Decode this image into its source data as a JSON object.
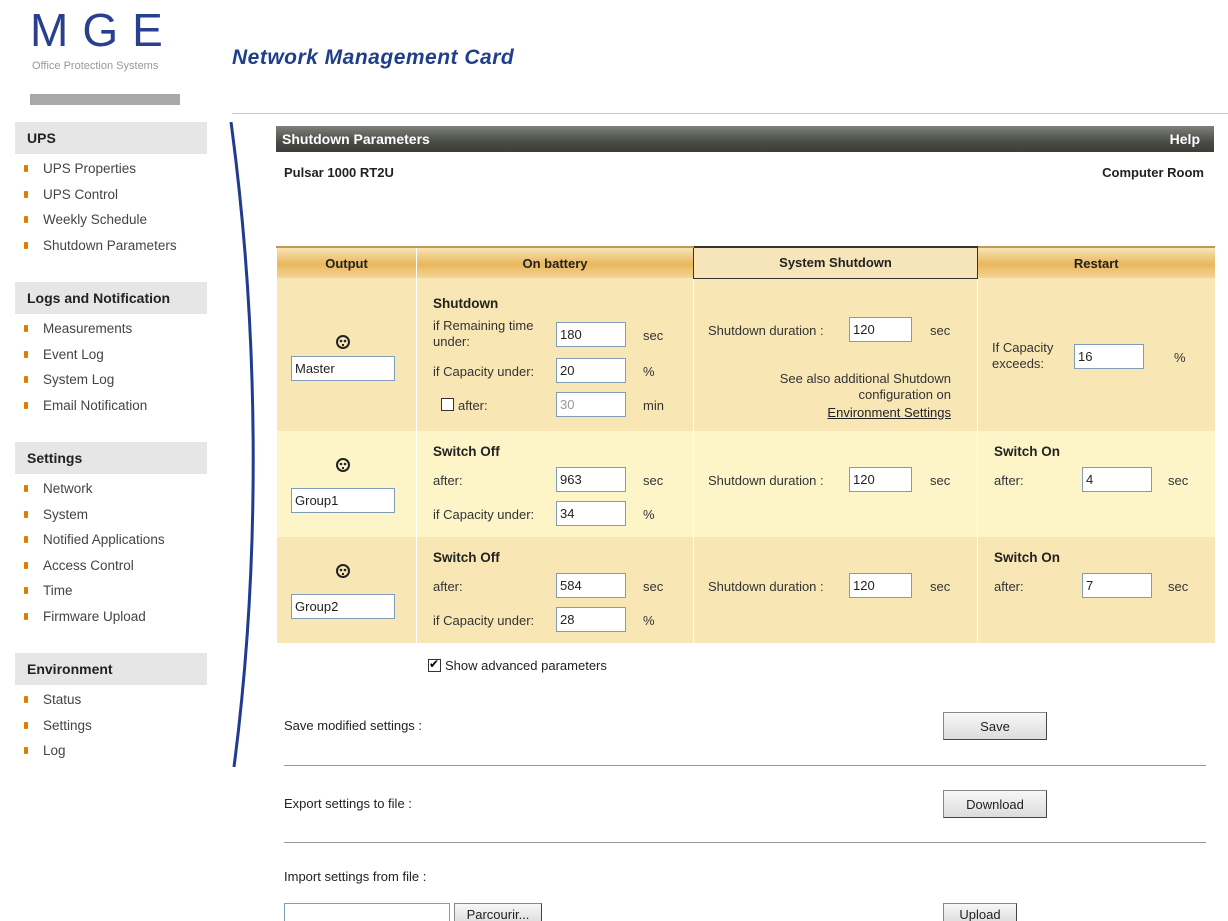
{
  "header": {
    "logo_text": "MGE",
    "logo_subtitle": "Office Protection Systems",
    "title": "Network  Management  Card"
  },
  "sidebar": [
    {
      "heading": "UPS",
      "items": [
        "UPS Properties",
        "UPS Control",
        "Weekly Schedule",
        "Shutdown Parameters"
      ]
    },
    {
      "heading": "Logs and Notification",
      "items": [
        "Measurements",
        "Event Log",
        "System Log",
        "Email Notification"
      ]
    },
    {
      "heading": "Settings",
      "items": [
        "Network",
        "System",
        "Notified Applications",
        "Access Control",
        "Time",
        "Firmware Upload"
      ]
    },
    {
      "heading": "Environment",
      "items": [
        "Status",
        "Settings",
        "Log"
      ]
    }
  ],
  "panel": {
    "title": "Shutdown Parameters",
    "help": "Help",
    "device": "Pulsar 1000 RT2U",
    "location": "Computer Room"
  },
  "table": {
    "headers": [
      "Output",
      "On battery",
      "System Shutdown",
      "Restart"
    ],
    "master": {
      "name": "Master",
      "section": "Shutdown",
      "remaining_label": "if Remaining time under:",
      "remaining_value": "180",
      "remaining_unit": "sec",
      "capacity_label": "if Capacity under:",
      "capacity_value": "20",
      "capacity_unit": "%",
      "after_label": "after:",
      "after_value": "30",
      "after_unit": "min",
      "after_checked": false,
      "shutdown_label": "Shutdown duration :",
      "shutdown_value": "120",
      "shutdown_unit": "sec",
      "note": "See also additional Shutdown configuration on",
      "note_link": "Environment Settings",
      "restart_label": "If Capacity exceeds:",
      "restart_value": "16",
      "restart_unit": "%"
    },
    "group1": {
      "name": "Group1",
      "section": "Switch Off",
      "after_label": "after:",
      "after_value": "963",
      "after_unit": "sec",
      "capacity_label": "if Capacity under:",
      "capacity_value": "34",
      "capacity_unit": "%",
      "shutdown_label": "Shutdown duration :",
      "shutdown_value": "120",
      "shutdown_unit": "sec",
      "restart_section": "Switch On",
      "restart_label": "after:",
      "restart_value": "4",
      "restart_unit": "sec"
    },
    "group2": {
      "name": "Group2",
      "section": "Switch Off",
      "after_label": "after:",
      "after_value": "584",
      "after_unit": "sec",
      "capacity_label": "if Capacity under:",
      "capacity_value": "28",
      "capacity_unit": "%",
      "shutdown_label": "Shutdown duration :",
      "shutdown_value": "120",
      "shutdown_unit": "sec",
      "restart_section": "Switch On",
      "restart_label": "after:",
      "restart_value": "7",
      "restart_unit": "sec"
    }
  },
  "advanced": {
    "label": "Show advanced parameters",
    "checked": true
  },
  "actions": {
    "save_label": "Save modified settings :",
    "save_button": "Save",
    "export_label": "Export settings to file :",
    "export_button": "Download",
    "import_label": "Import settings from file :",
    "browse_button": "Parcourir...",
    "upload_button": "Upload",
    "file_value": ""
  }
}
